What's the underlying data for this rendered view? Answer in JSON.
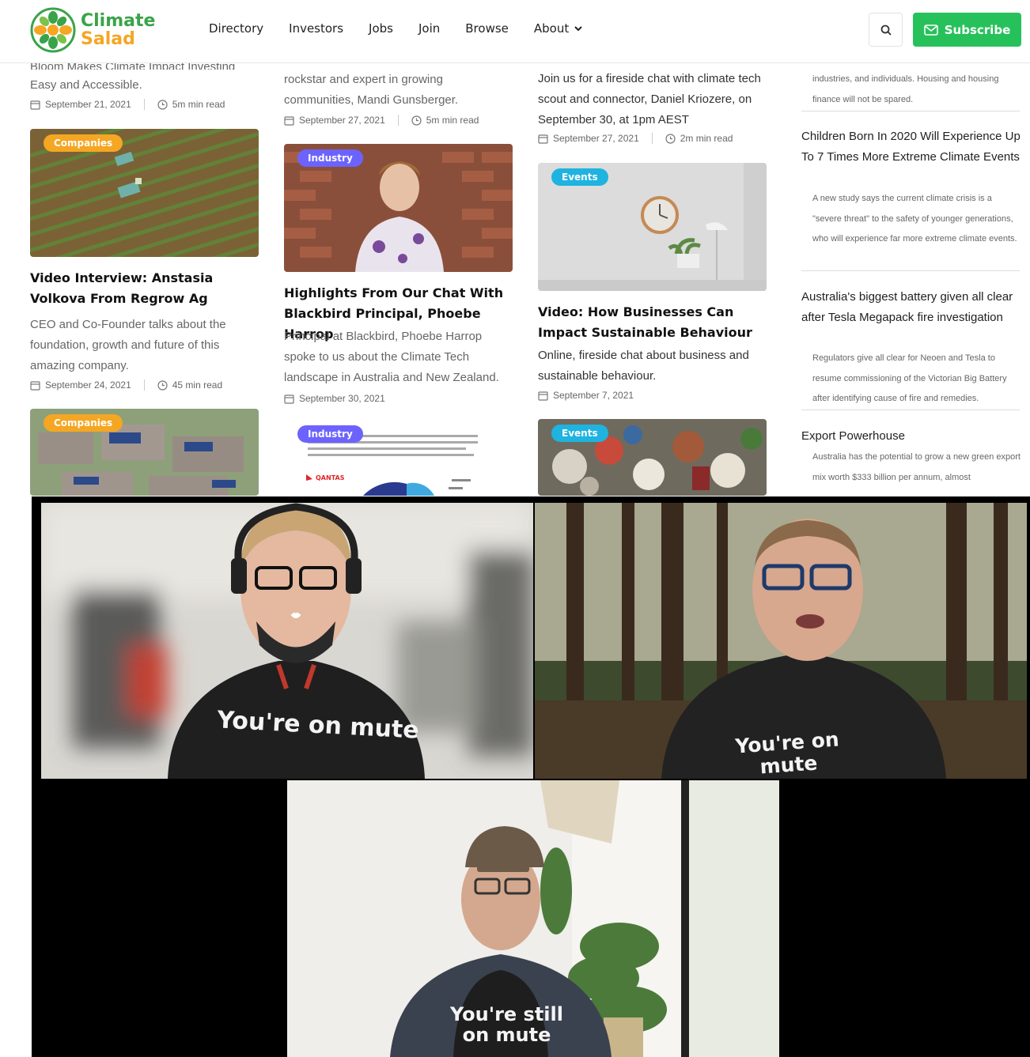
{
  "header": {
    "logo_line1": "Climate",
    "logo_line2": "Salad",
    "nav": [
      "Directory",
      "Investors",
      "Jobs",
      "Join",
      "Browse",
      "About"
    ],
    "subscribe_label": "Subscribe",
    "colors": {
      "green": "#27c15b",
      "orange": "#f5a623"
    }
  },
  "columns": {
    "col1": {
      "top_excerpt_cut": "Bloom Makes Climate Impact Investing",
      "top_excerpt": "Easy and Accessible.",
      "top_date": "September 21, 2021",
      "top_read": "5m min read",
      "card1": {
        "badge": "Companies",
        "title": "Video Interview: Anstasia Volkova From Regrow Ag",
        "excerpt": "CEO and Co-Founder talks about the foundation, growth and future of this amazing company.",
        "date": "September 24, 2021",
        "read": "45 min read"
      },
      "card2": {
        "badge": "Companies"
      }
    },
    "col2": {
      "top_excerpt": "rockstar and expert in growing communities, Mandi Gunsberger.",
      "top_date": "September 27, 2021",
      "top_read": "5m min read",
      "card1": {
        "badge": "Industry",
        "title": "Highlights From Our Chat With Blackbird Principal, Phoebe Harrop",
        "excerpt": "Principal at Blackbird, Phoebe Harrop spoke to us about the Climate Tech landscape in Australia and New Zealand.",
        "date": "September 30, 2021"
      },
      "card2": {
        "badge": "Industry",
        "logo": "QANTAS"
      }
    },
    "col3": {
      "top_excerpt": "Join us for a fireside chat with climate tech scout and connector, Daniel Kriozere, on September 30, at 1pm AEST",
      "top_date": "September 27, 2021",
      "top_read": "2m min read",
      "card1": {
        "badge": "Events",
        "title": "Video: How Businesses Can Impact Sustainable Behaviour",
        "excerpt": "Online, fireside chat about business and sustainable behaviour.",
        "date": "September 7, 2021"
      },
      "card2": {
        "badge": "Events"
      }
    }
  },
  "sidebar": [
    {
      "title": "",
      "text": "industries, and individuals. Housing and housing finance will not be spared."
    },
    {
      "title": "Children Born In 2020 Will Experience Up To 7 Times More Extreme Climate Events",
      "text": "A new study says the current climate crisis is a \"severe threat\" to the safety of younger generations, who will experience far more extreme climate events."
    },
    {
      "title": "Australia's biggest battery given all clear after Tesla Megapack fire investigation",
      "text": "Regulators give all clear for Neoen and Tesla to resume commissioning of the Victorian Big Battery after identifying cause of fire and remedies."
    },
    {
      "title": "Export Powerhouse",
      "text": "Australia has the potential to grow a new green export mix worth $333 billion per annum, almost"
    }
  ],
  "video_call": {
    "shirt1": "You're on mute",
    "shirt2": "You're on mute",
    "shirt3_line1": "You're still",
    "shirt3_line2": "on mute"
  }
}
